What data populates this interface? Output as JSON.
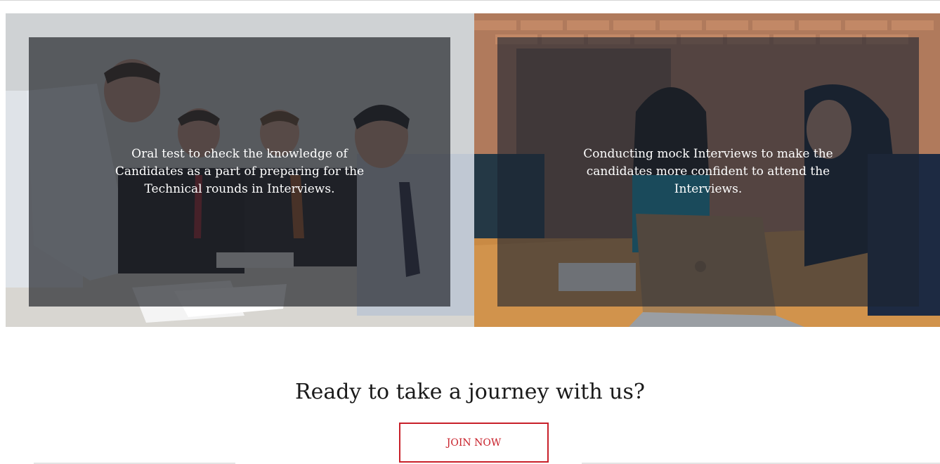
{
  "gallery": {
    "items": [
      {
        "caption": "Oral test to check the knowledge of Candidates as a part of preparing for the Technical rounds in Interviews.",
        "image": "men-at-meeting-table-photo"
      },
      {
        "caption": "Conducting mock Interviews to make the candidates more confident to attend the Interviews.",
        "image": "women-interview-laptop-photo"
      }
    ]
  },
  "cta": {
    "heading": "Ready to take a journey with us?",
    "button_label": "JOIN NOW"
  },
  "colors": {
    "accent": "#c8202a",
    "overlay": "#1e2026",
    "heading": "#1a1a1a"
  }
}
